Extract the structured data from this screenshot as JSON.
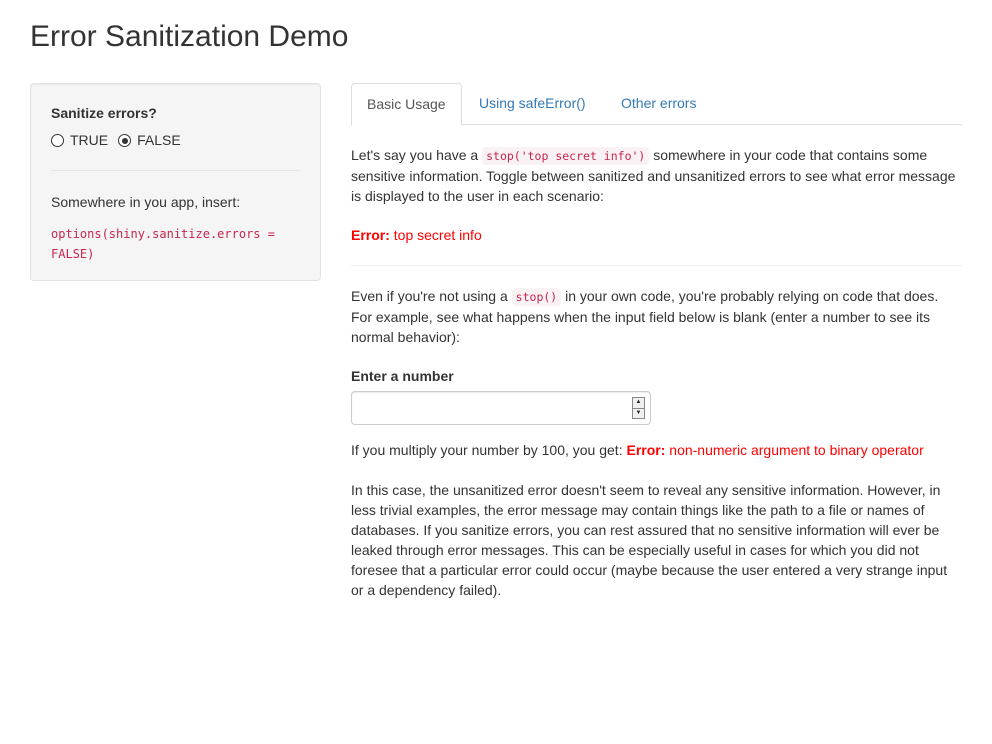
{
  "page": {
    "title": "Error Sanitization Demo"
  },
  "sidebar": {
    "label": "Sanitize errors?",
    "options": [
      {
        "label": "TRUE",
        "checked": false
      },
      {
        "label": "FALSE",
        "checked": true
      }
    ],
    "insert_text": "Somewhere in you app, insert:",
    "code": "options(shiny.sanitize.errors = FALSE)"
  },
  "tabs": [
    {
      "label": "Basic Usage",
      "active": true
    },
    {
      "label": "Using safeError()",
      "active": false
    },
    {
      "label": "Other errors",
      "active": false
    }
  ],
  "main": {
    "para1_pre": "Let's say you have a ",
    "para1_code": "stop('top secret info')",
    "para1_post": " somewhere in your code that contains some sensitive information. Toggle between sanitized and unsanitized errors to see what error message is displayed to the user in each scenario:",
    "error1_label": "Error:",
    "error1_msg": " top secret info",
    "para2_pre": "Even if you're not using a ",
    "para2_code": "stop()",
    "para2_post": " in your own code, you're probably relying on code that does. For example, see what happens when the input field below is blank (enter a number to see its normal behavior):",
    "number_label": "Enter a number",
    "number_value": "",
    "multiply_text": "If you multiply your number by 100, you get: ",
    "error2_label": "Error:",
    "error2_msg": " non-numeric argument to binary operator",
    "para3": "In this case, the unsanitized error doesn't seem to reveal any sensitive information. However, in less trivial examples, the error message may contain things like the path to a file or names of databases. If you sanitize errors, you can rest assured that no sensitive information will ever be leaked through error messages. This can be especially useful in cases for which you did not foresee that a particular error could occur (maybe because the user entered a very strange input or a dependency failed)."
  },
  "colors": {
    "accent": "#337ab7",
    "error": "#ff0000",
    "code": "#c7254e"
  }
}
